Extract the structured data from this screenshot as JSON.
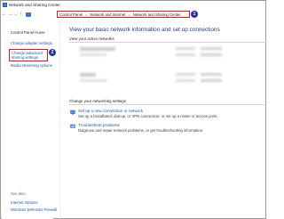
{
  "window": {
    "title": "Network and Sharing Center"
  },
  "address_bar": {
    "nav": {
      "back": "←",
      "forward": "→",
      "dropdown": "⌄",
      "up": "↑"
    },
    "breadcrumb": [
      "Control Panel",
      "Network and Internet",
      "Network and Sharing Center"
    ],
    "separator": ">"
  },
  "callouts": [
    "1",
    "2"
  ],
  "sidebar": {
    "home": "Control Panel Home",
    "items": [
      "Change adapter settings",
      "Change advanced sharing settings",
      "Media streaming options"
    ],
    "see_also_label": "See also",
    "see_also": [
      "Internet Options",
      "Windows Defender Firewall"
    ]
  },
  "main": {
    "heading": "View your basic network information and set up connections",
    "active_networks_label": "View your active networks",
    "settings_label": "Change your networking settings",
    "tasks": [
      {
        "link": "Set up a new connection or network",
        "desc": "Set up a broadband, dial-up, or VPN connection; or set up a router or access point."
      },
      {
        "link": "Troubleshoot problems",
        "desc": "Diagnose and repair network problems, or get troubleshooting information."
      }
    ]
  },
  "colors": {
    "highlight": "#e3141a",
    "callout": "#2b2fa0",
    "link": "#1a57b4",
    "heading": "#1f3a8c"
  }
}
